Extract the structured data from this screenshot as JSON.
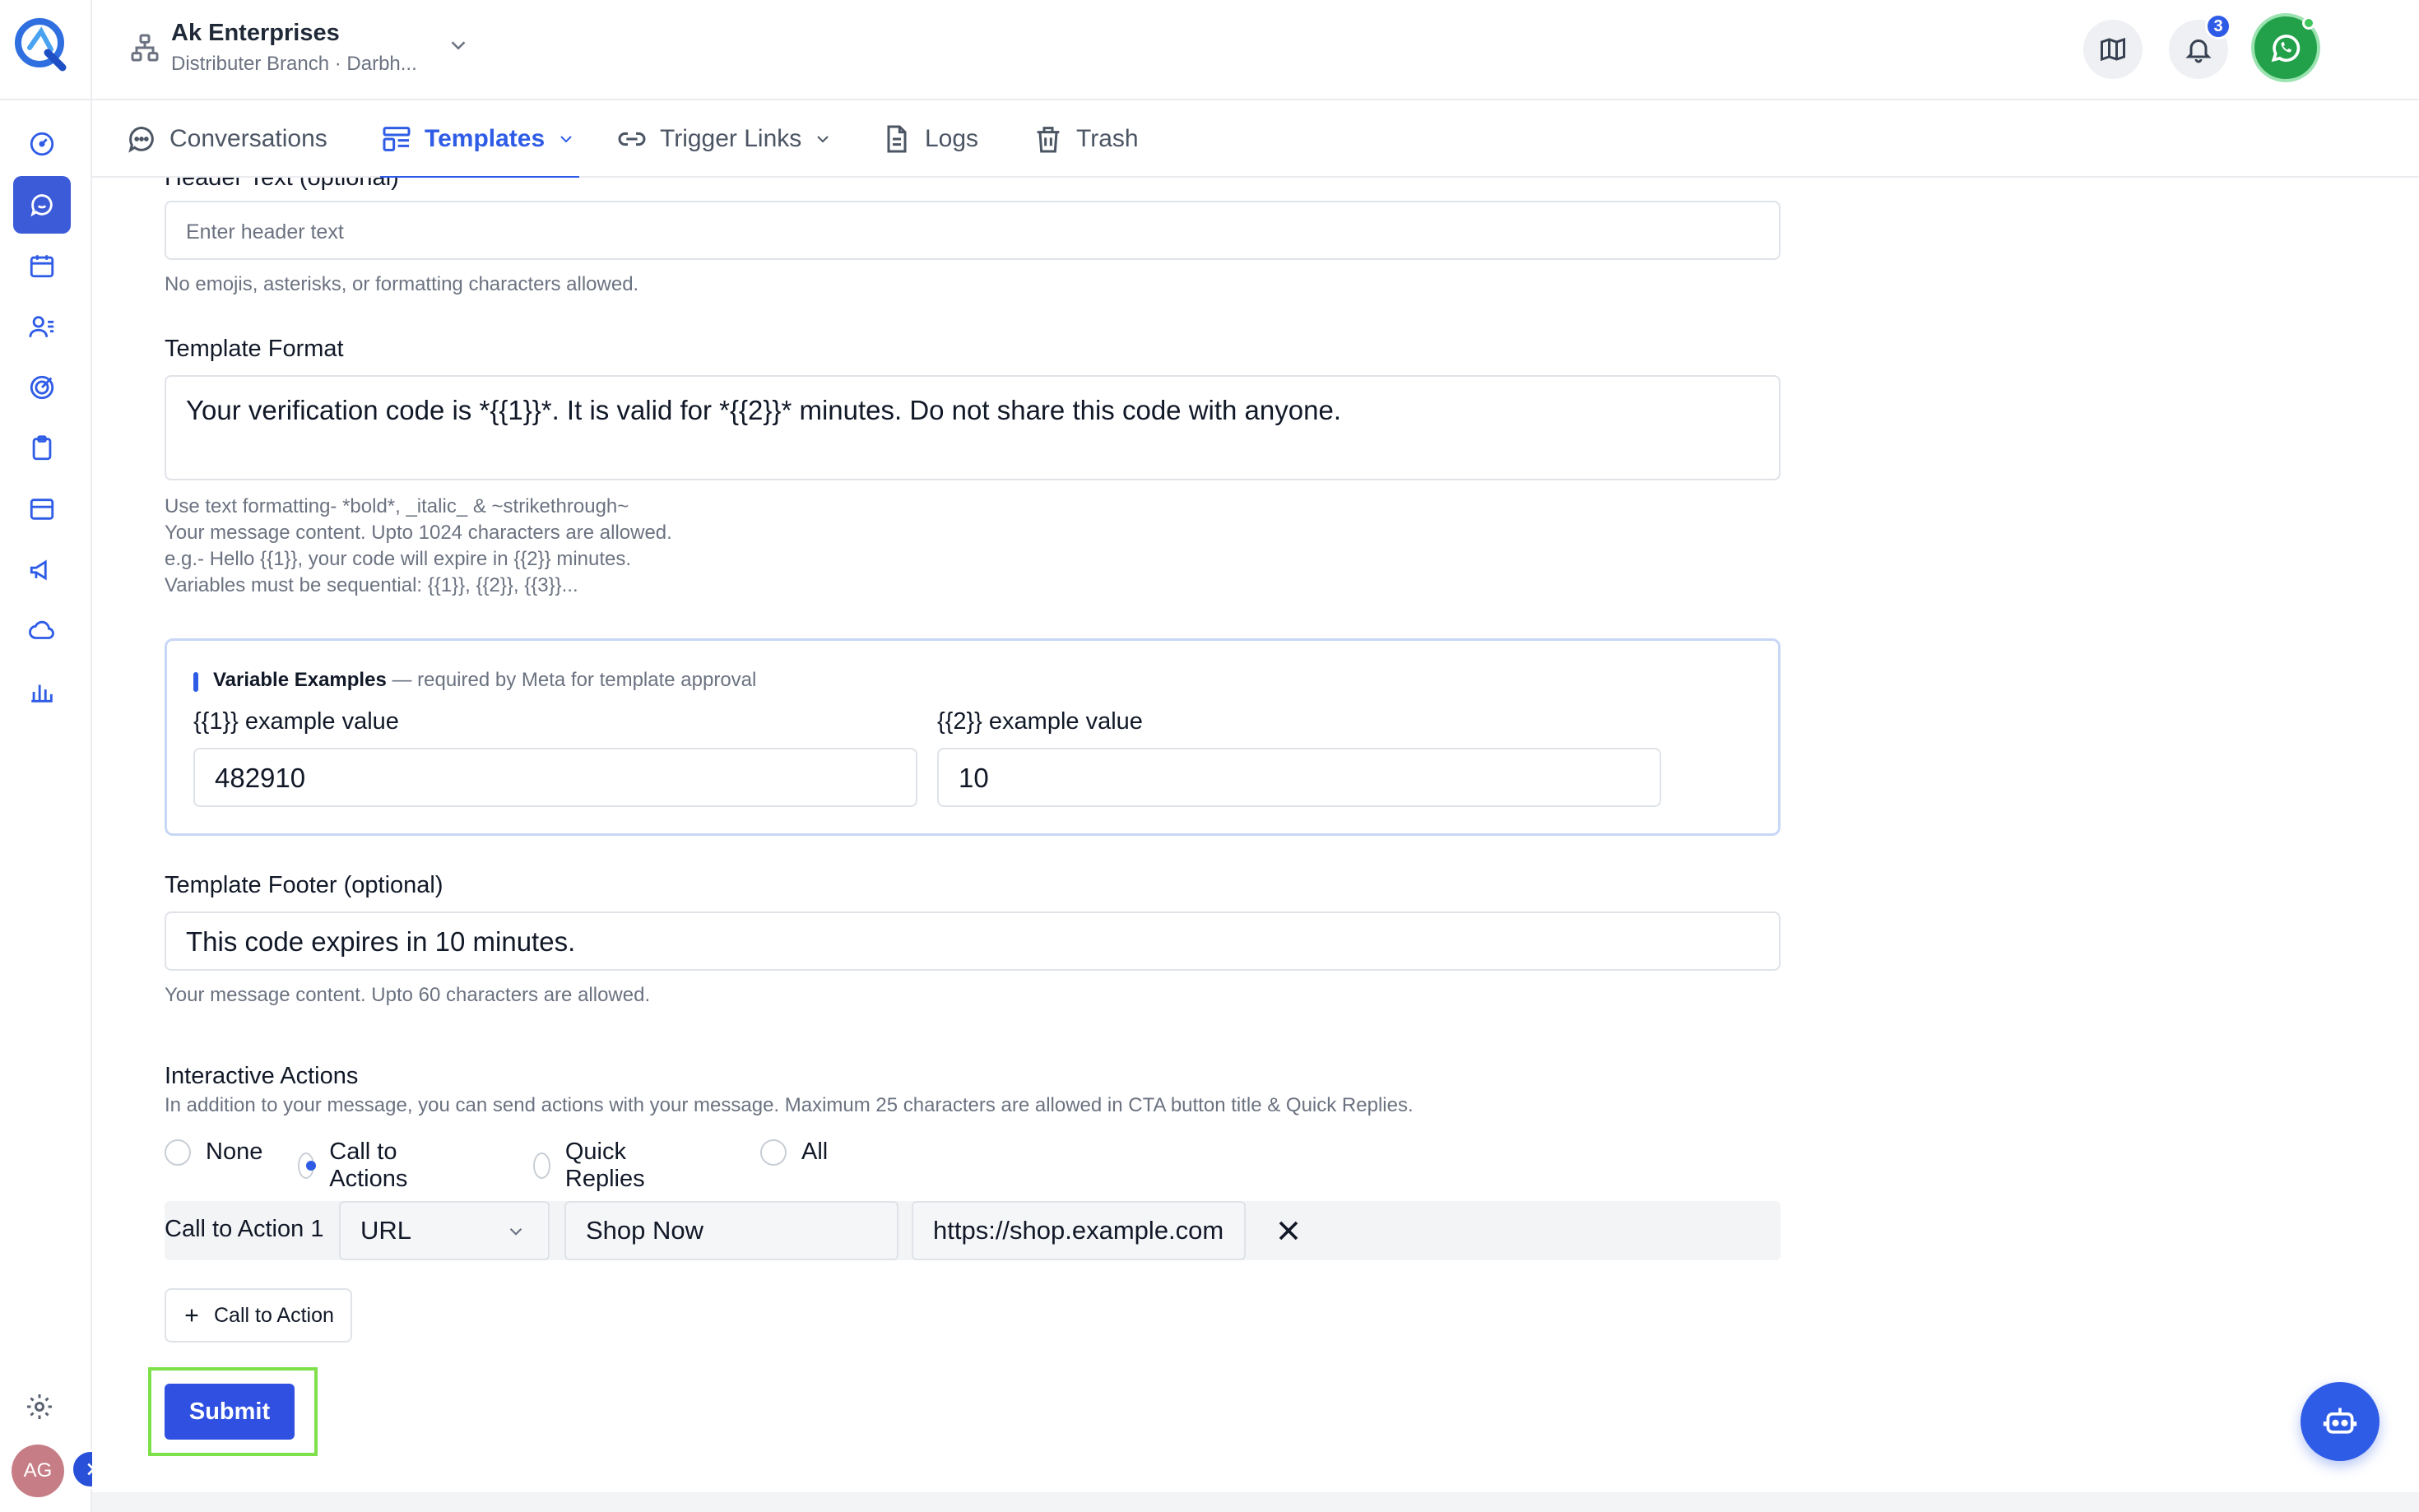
{
  "header": {
    "org_name": "Ak Enterprises",
    "org_sub": "Distributer Branch · Darbh...",
    "notification_count": "3",
    "avatar_initials": "AG"
  },
  "tabs": [
    {
      "label": "Conversations",
      "icon": "chat-bubble-icon"
    },
    {
      "label": "Templates",
      "icon": "template-layout-icon",
      "active": true
    },
    {
      "label": "Trigger Links",
      "icon": "link-icon"
    },
    {
      "label": "Logs",
      "icon": "document-icon"
    },
    {
      "label": "Trash",
      "icon": "trash-icon"
    }
  ],
  "sidebar": {
    "items": [
      "dashboard-gauge-icon",
      "chat-icon",
      "calendar-icon",
      "contacts-list-icon",
      "target-icon",
      "clipboard-icon",
      "inbox-icon",
      "megaphone-icon",
      "cloud-icon",
      "bar-chart-icon"
    ],
    "active_index": 1,
    "avatar_initials": "AG"
  },
  "form": {
    "header_text": {
      "label": "Header Text (optional)",
      "placeholder": "Enter header text",
      "hint": "No emojis, asterisks, or formatting characters allowed."
    },
    "template_format": {
      "label": "Template Format",
      "value": "Your verification code is *{{1}}*. It is valid for *{{2}}* minutes. Do not share this code with anyone.",
      "hints": [
        "Use text formatting- *bold*, _italic_ & ~strikethrough~",
        "Your message content. Upto 1024 characters are allowed.",
        "e.g.- Hello {{1}}, your code will expire in {{2}} minutes.",
        "Variables must be sequential: {{1}}, {{2}}, {{3}}..."
      ]
    },
    "variable_examples": {
      "title": "Variable Examples",
      "subtitle": "— required by Meta for template approval",
      "var1_label": "{{1}} example value",
      "var1_value": "482910",
      "var2_label": "{{2}} example value",
      "var2_value": "10"
    },
    "footer": {
      "label": "Template Footer (optional)",
      "value": "This code expires in 10 minutes.",
      "hint": "Your message content. Upto 60 characters are allowed."
    },
    "interactive": {
      "label": "Interactive Actions",
      "hint": "In addition to your message, you can send actions with your message. Maximum 25 characters are allowed in CTA button title & Quick Replies.",
      "options": [
        "None",
        "Call to Actions",
        "Quick Replies",
        "All"
      ],
      "selected": "Call to Actions"
    },
    "cta": {
      "label": "Call to Action 1",
      "type": "URL",
      "title": "Shop Now",
      "url": "https://shop.example.com"
    },
    "add_cta_label": "Call to Action",
    "submit_label": "Submit"
  },
  "colors": {
    "accent": "#2f5ce6",
    "whatsapp": "#22a14a",
    "avatar": "#c77d85",
    "highlight": "#7ee04a"
  }
}
